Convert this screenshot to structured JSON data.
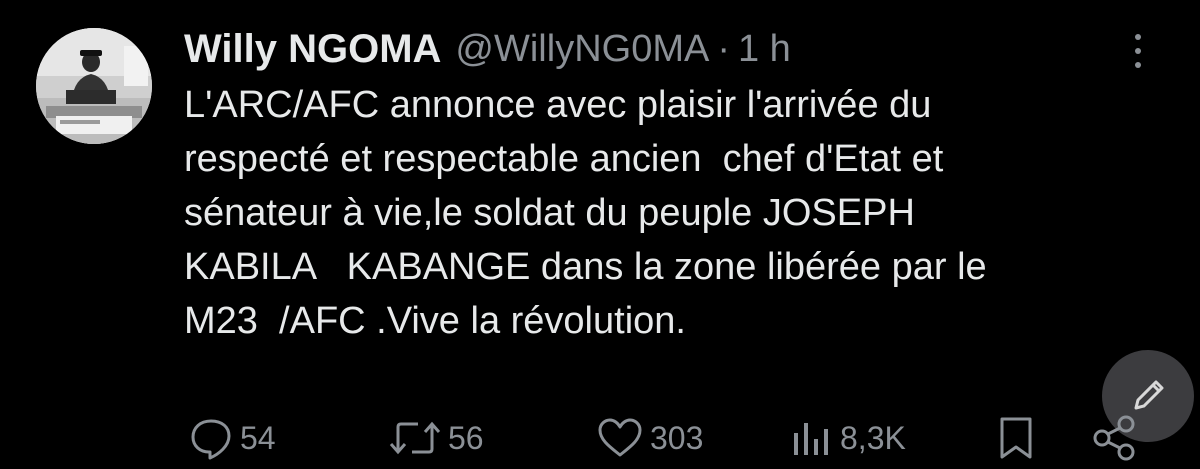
{
  "user": {
    "name": "Willy NGOMA",
    "handle": "@WillyNG0MA",
    "separator": "·",
    "time": "1 h"
  },
  "tweet": {
    "text": "L'ARC/AFC annonce avec plaisir l'arrivée du\nrespecté et respectable ancien  chef d'Etat et\nsénateur à vie,le soldat du peuple JOSEPH\nKABILA   KABANGE dans la zone libérée par le\nM23  /AFC .Vive la révolution."
  },
  "actions": {
    "replies": "54",
    "reposts": "56",
    "likes": "303",
    "views": "8,3K"
  },
  "icons": {
    "reply": "reply-icon",
    "repost": "repost-icon",
    "like": "heart-icon",
    "views": "views-icon",
    "bookmark": "bookmark-icon",
    "share": "share-icon",
    "more": "more-icon",
    "compose": "compose-icon"
  },
  "colors": {
    "background": "#000000",
    "text": "#e7e9ea",
    "secondary": "#8b9096"
  }
}
